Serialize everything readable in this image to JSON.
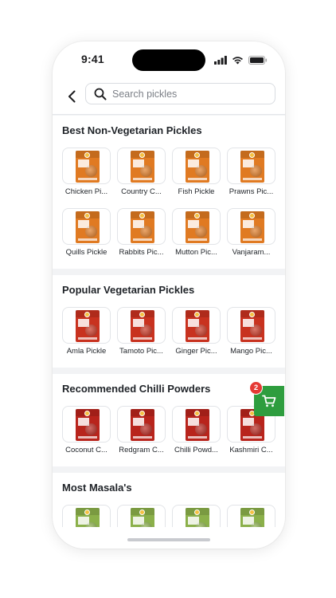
{
  "status_bar": {
    "time": "9:41"
  },
  "header": {
    "search_placeholder": "Search pickles"
  },
  "sections": [
    {
      "title": "Best Non-Vegetarian Pickles",
      "items": [
        {
          "name": "Chicken Pi...",
          "color": "#e07a22"
        },
        {
          "name": "Country C...",
          "color": "#e07a22"
        },
        {
          "name": "Fish Pickle",
          "color": "#e07a22"
        },
        {
          "name": "Prawns Pic...",
          "color": "#e07a22"
        },
        {
          "name": "Quills Pickle",
          "color": "#e07a22"
        },
        {
          "name": "Rabbits Pic...",
          "color": "#e07a22"
        },
        {
          "name": "Mutton Pic...",
          "color": "#e07a22"
        },
        {
          "name": "Vanjaram...",
          "color": "#e07a22"
        }
      ]
    },
    {
      "title": "Popular Vegetarian Pickles",
      "items": [
        {
          "name": "Amla Pickle",
          "color": "#c8321f"
        },
        {
          "name": "Tamoto Pic...",
          "color": "#c8321f"
        },
        {
          "name": "Ginger Pic...",
          "color": "#c8321f"
        },
        {
          "name": "Mango Pic...",
          "color": "#c8321f"
        }
      ]
    },
    {
      "title": "Recommended Chilli Powders",
      "items": [
        {
          "name": "Coconut C...",
          "color": "#b8241c"
        },
        {
          "name": "Redgram C...",
          "color": "#b8241c"
        },
        {
          "name": "Chilli Powd...",
          "color": "#b8241c"
        },
        {
          "name": "Kashmiri C...",
          "color": "#b8241c"
        }
      ]
    },
    {
      "title": "Most Masala's",
      "items": [
        {
          "name": "",
          "color": "#8bb04a"
        },
        {
          "name": "",
          "color": "#8bb04a"
        },
        {
          "name": "",
          "color": "#8bb04a"
        },
        {
          "name": "",
          "color": "#8bb04a"
        }
      ]
    }
  ],
  "cart": {
    "count": "2",
    "color": "#2e9d3e"
  }
}
